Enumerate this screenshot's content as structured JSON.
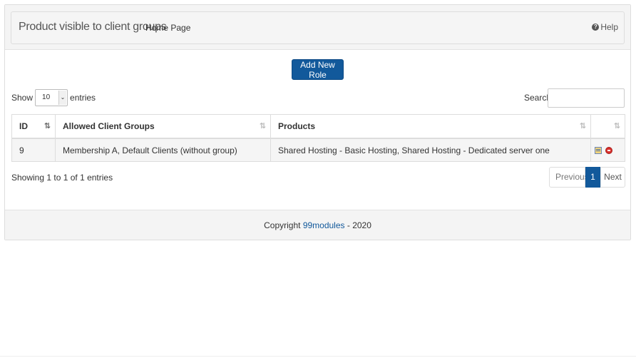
{
  "header": {
    "title": "Product visible to client groups",
    "breadcrumb": "Home Page",
    "help_label": "Help"
  },
  "actions": {
    "add_label": "Add New Role"
  },
  "length_menu": {
    "prefix": "Show",
    "value": "10",
    "suffix": "entries"
  },
  "search": {
    "label": "Search:",
    "value": ""
  },
  "table": {
    "columns": [
      "ID",
      "Allowed Client Groups",
      "Products",
      ""
    ],
    "rows": [
      {
        "id": "9",
        "groups": "Membership A, Default Clients (without group)",
        "products": "Shared Hosting - Basic Hosting, Shared Hosting - Dedicated server one"
      }
    ]
  },
  "info": "Showing 1 to 1 of 1 entries",
  "pagination": {
    "previous": "Previous",
    "current": "1",
    "next": "Next"
  },
  "footer": {
    "prefix": "Copyright ",
    "link": "99modules",
    "suffix": " - 2020"
  },
  "colors": {
    "primary": "#12599b",
    "panel_bg": "#f4f4f4"
  },
  "icons": [
    "help-icon",
    "sort-asc-icon",
    "sort-icon",
    "edit-icon",
    "delete-icon",
    "chevron-down-icon"
  ]
}
